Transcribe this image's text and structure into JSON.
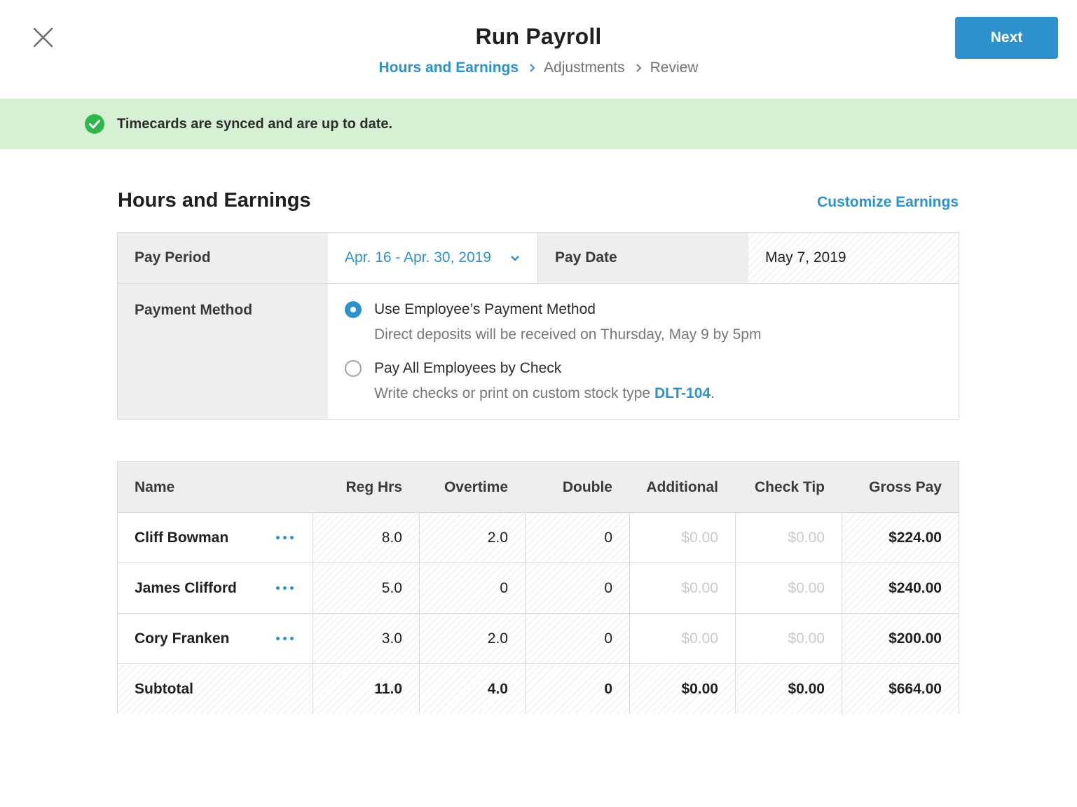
{
  "header": {
    "title": "Run Payroll",
    "next_label": "Next",
    "breadcrumb": [
      {
        "label": "Hours and Earnings",
        "active": true
      },
      {
        "label": "Adjustments",
        "active": false
      },
      {
        "label": "Review",
        "active": false
      }
    ],
    "icons": {
      "close": "close-icon",
      "chevron": "chevron-right-icon"
    }
  },
  "banner": {
    "text": "Timecards are synced and are up to date.",
    "icon": "check-circle-icon",
    "color": "#2fb84a"
  },
  "section": {
    "title": "Hours and Earnings",
    "customize_label": "Customize Earnings"
  },
  "settings": {
    "pay_period_label": "Pay Period",
    "pay_period_value": "Apr. 16 - Apr. 30, 2019",
    "pay_date_label": "Pay Date",
    "pay_date_value": "May 7, 2019",
    "payment_method_label": "Payment Method",
    "options": [
      {
        "label": "Use Employee’s Payment Method",
        "description": "Direct deposits will be received on Thursday, May 9 by 5pm",
        "selected": true
      },
      {
        "label": "Pay All Employees by Check",
        "description_prefix": "Write checks or print on custom stock type ",
        "description_link": "DLT-104",
        "description_suffix": ".",
        "selected": false
      }
    ]
  },
  "table": {
    "columns": [
      "Name",
      "Reg Hrs",
      "Overtime",
      "Double",
      "Additional",
      "Check Tip",
      "Gross Pay"
    ],
    "rows": [
      {
        "name": "Cliff Bowman",
        "reg": "8.0",
        "ot": "2.0",
        "double": "0",
        "additional": "$0.00",
        "tip": "$0.00",
        "gross": "$224.00"
      },
      {
        "name": "James Clifford",
        "reg": "5.0",
        "ot": "0",
        "double": "0",
        "additional": "$0.00",
        "tip": "$0.00",
        "gross": "$240.00"
      },
      {
        "name": "Cory Franken",
        "reg": "3.0",
        "ot": "2.0",
        "double": "0",
        "additional": "$0.00",
        "tip": "$0.00",
        "gross": "$200.00"
      }
    ],
    "subtotal": {
      "name": "Subtotal",
      "reg": "11.0",
      "ot": "4.0",
      "double": "0",
      "additional": "$0.00",
      "tip": "$0.00",
      "gross": "$664.00"
    }
  },
  "colors": {
    "accent": "#2d92cc",
    "banner_bg": "#d5f0d3"
  }
}
